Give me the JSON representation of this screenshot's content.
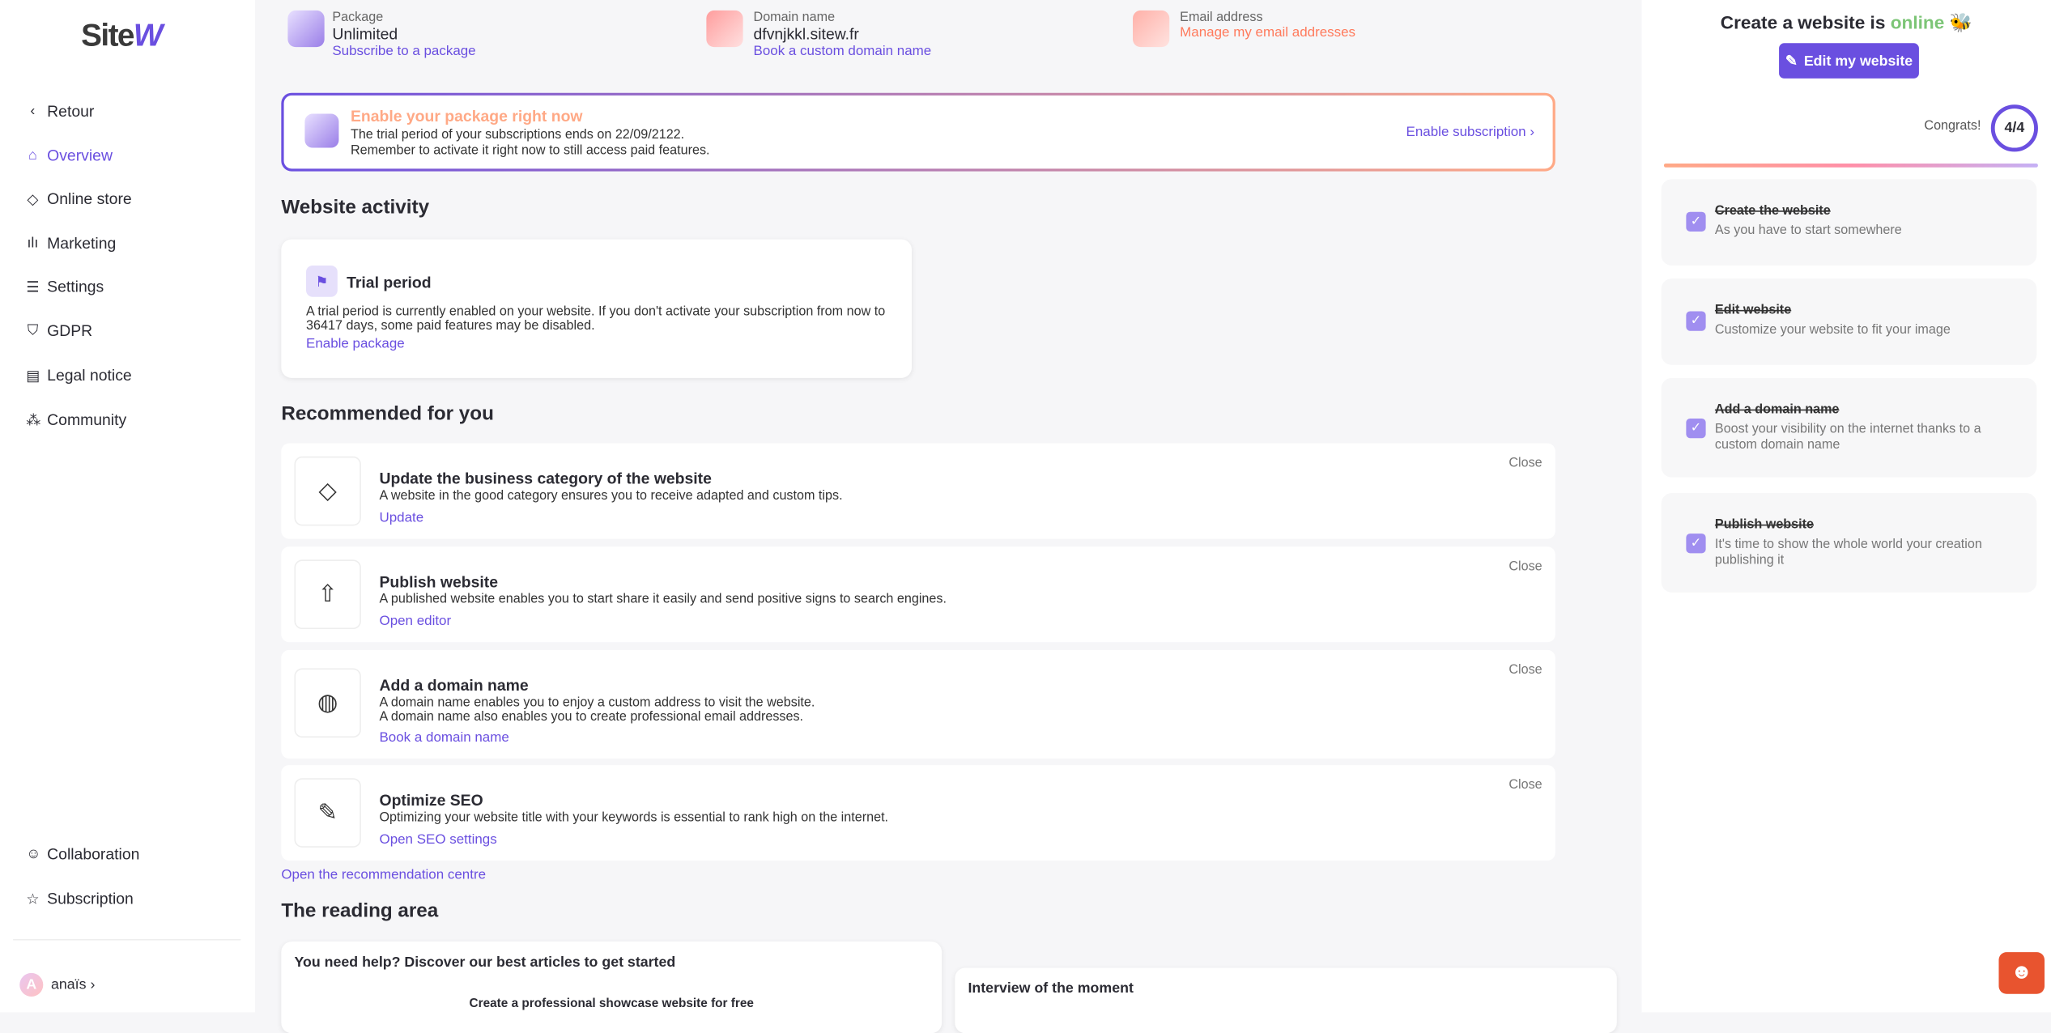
{
  "brand": {
    "logo_text": "Site",
    "logo_accent": "W",
    "accent_color": "#6a4fe0"
  },
  "sidebar": {
    "back": "Retour",
    "items": [
      {
        "label": "Overview",
        "icon": "home-icon",
        "active": true
      },
      {
        "label": "Online store",
        "icon": "tag-icon"
      },
      {
        "label": "Marketing",
        "icon": "bar-chart-icon"
      },
      {
        "label": "Settings",
        "icon": "sliders-icon"
      },
      {
        "label": "GDPR",
        "icon": "shield-icon"
      },
      {
        "label": "Legal notice",
        "icon": "document-icon"
      },
      {
        "label": "Community",
        "icon": "community-icon"
      }
    ],
    "bottom_items": [
      {
        "label": "Collaboration",
        "icon": "users-icon"
      },
      {
        "label": "Subscription",
        "icon": "star-icon"
      }
    ],
    "user": {
      "initial": "A",
      "name": "anaïs"
    }
  },
  "info": [
    {
      "label": "Package",
      "value": "Unlimited",
      "link": "Subscribe to a package"
    },
    {
      "label": "Domain name",
      "value": "dfvnjkkl.sitew.fr",
      "link": "Book a custom domain name"
    },
    {
      "label": "Email address",
      "value": "",
      "link": "Manage my email addresses"
    }
  ],
  "banner": {
    "title": "Enable your package right now",
    "line1": "The trial period of your subscriptions ends on 22/09/2122.",
    "line2": "Remember to activate it right now to still access paid features.",
    "link": "Enable subscription"
  },
  "activity": {
    "heading": "Website activity",
    "card_title": "Trial period",
    "text": "A trial period is currently enabled on your website. If you don't activate your subscription from now to 36417 days, some paid features may be disabled.",
    "link": "Enable package"
  },
  "recommended": {
    "heading": "Recommended for you",
    "close": "Close",
    "items": [
      {
        "title": "Update the business category of the website",
        "desc": "A website in the good category ensures you to receive adapted and custom tips.",
        "link": "Update",
        "icon": "tag-icon"
      },
      {
        "title": "Publish website",
        "desc": "A published website enables you to start share it easily and send positive signs to search engines.",
        "link": "Open editor",
        "icon": "upload-cloud-icon"
      },
      {
        "title": "Add a domain name",
        "desc": "A domain name enables you to enjoy a custom address to visit the website.",
        "desc2": "A domain name also enables you to create professional email addresses.",
        "link": "Book a domain name",
        "icon": "globe-icon"
      },
      {
        "title": "Optimize SEO",
        "desc": "Optimizing your website title with your keywords is essential to rank high on the internet.",
        "link": "Open SEO settings",
        "icon": "pencil-icon"
      }
    ],
    "centre_link": "Open the recommendation centre"
  },
  "reading": {
    "heading": "The reading area",
    "help_title": "You need help? Discover our best articles to get started",
    "article": "Create a professional showcase website for free",
    "interview": "Interview of the moment"
  },
  "right": {
    "title_prefix": "Create a website is",
    "title_status": "online",
    "status_color": "#7cc576",
    "edit_button": "Edit my website",
    "congrats": "Congrats!",
    "progress": "4/4",
    "progress_value": 1.0,
    "steps": [
      {
        "title": "Create the website",
        "desc": "As you have to start somewhere",
        "done": true
      },
      {
        "title": "Edit website",
        "desc": "Customize your website to fit your image",
        "done": true
      },
      {
        "title": "Add a domain name",
        "desc": "Boost your visibility on the internet thanks to a custom domain name",
        "done": true
      },
      {
        "title": "Publish website",
        "desc": "It's time to show the whole world your creation publishing it",
        "done": true
      }
    ]
  }
}
